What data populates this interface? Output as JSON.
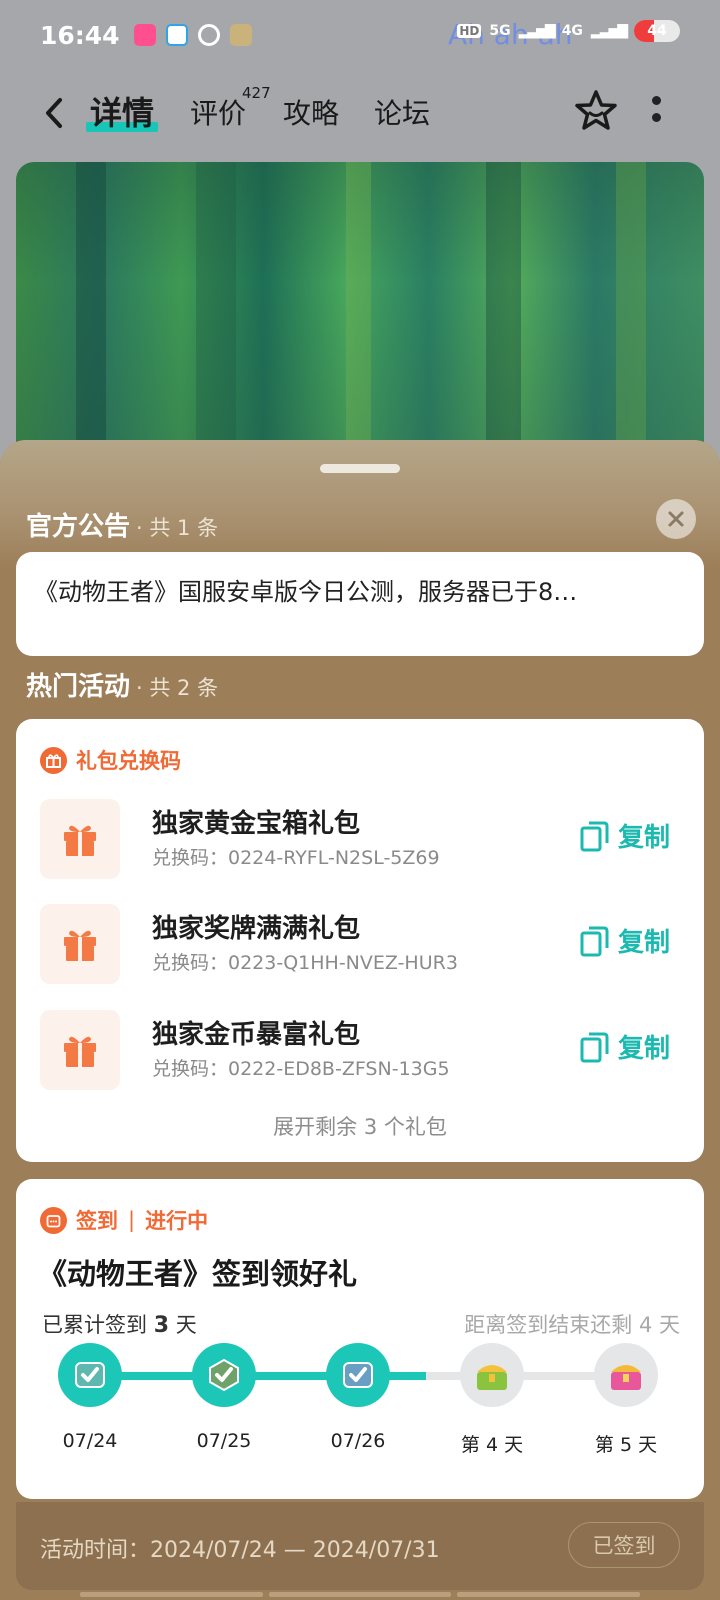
{
  "status_bar": {
    "time": "16:44",
    "overlay_text": "Ah ah ah",
    "network_1": "5G",
    "network_2": "4G",
    "battery_level": "44",
    "battery_fraction": 0.44
  },
  "nav": {
    "tabs": [
      {
        "label": "详情",
        "active": true
      },
      {
        "label": "评价",
        "badge": "427"
      },
      {
        "label": "攻略"
      },
      {
        "label": "论坛"
      }
    ]
  },
  "announcement": {
    "title": "官方公告",
    "count": "· 共 1 条",
    "text": "《动物王者》国服安卓版今日公测，服务器已于8…"
  },
  "activities": {
    "title": "热门活动",
    "count": "· 共 2 条"
  },
  "gift_card": {
    "label": "礼包兑换码",
    "items": [
      {
        "name": "独家黄金宝箱礼包",
        "code": "兑换码：0224-RYFL-N2SL-5Z69",
        "copy": "复制"
      },
      {
        "name": "独家奖牌满满礼包",
        "code": "兑换码：0223-Q1HH-NVEZ-HUR3",
        "copy": "复制"
      },
      {
        "name": "独家金币暴富礼包",
        "code": "兑换码：0222-ED8B-ZFSN-13G5",
        "copy": "复制"
      }
    ],
    "expand": "展开剩余 3 个礼包"
  },
  "sign_card": {
    "label": "签到",
    "status": "进行中",
    "title": "《动物王者》签到领好礼",
    "progress_prefix": "已累计签到",
    "progress_days": "3",
    "progress_suffix": "天",
    "remaining": "距离签到结束还剩 4 天",
    "days": [
      {
        "label": "07/24",
        "done": true
      },
      {
        "label": "07/25",
        "done": true
      },
      {
        "label": "07/26",
        "done": true
      },
      {
        "label": "第 4 天",
        "done": false
      },
      {
        "label": "第 5 天",
        "done": false
      }
    ],
    "activity_time": "活动时间：2024/07/24 — 2024/07/31",
    "signed_button": "已签到"
  },
  "colors": {
    "accent": "#1cc7b8",
    "orange": "#f06a35",
    "sheet": "#9c7e58"
  }
}
